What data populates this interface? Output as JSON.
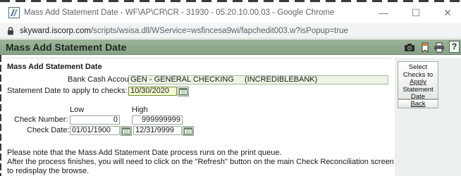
{
  "browser": {
    "window_title": "Mass Add Statement Date - WF\\AP\\CR\\CR - 31930 - 05.20.10.00.03 - Google Chrome",
    "url_host": "skyward.iscorp.com",
    "url_path": "/scripts/wsisa.dll/WService=wsfincesa9wi/fapchedit003.w?isPopup=true",
    "controls": {
      "minimize": "—",
      "maximize": "☐",
      "close": "✕"
    }
  },
  "header": {
    "title": "Mass Add Statement Date",
    "icons": [
      "camera-icon",
      "bookmark-icon",
      "print-icon",
      "help-icon"
    ],
    "help_label": "?"
  },
  "form": {
    "section_title": "Mass Add Statement Date",
    "bank_account": {
      "label": "Bank Cash Account:",
      "value": "GEN - GENERAL CHECKING",
      "bank_name": "(INCREDIBLEBANK)"
    },
    "statement_date": {
      "label": "Statement Date to apply to checks:",
      "value": "10/30/2020"
    },
    "range_headers": {
      "low": "Low",
      "high": "High"
    },
    "check_number": {
      "label": "Check Number:",
      "low": "0",
      "high": "999999999"
    },
    "check_date": {
      "label": "Check Date:",
      "low": "01/01/1900",
      "high": "12/31/9999"
    },
    "notes": [
      "Please note that the Mass Add Statement Date process runs on the print queue.",
      "After the process finishes, you will need to click on the \"Refresh\" button on the main Check Reconciliation screen",
      "to redisplay the browse."
    ]
  },
  "actions": {
    "select_checks_lines": [
      "Select",
      "Checks to",
      "Apply",
      "Statement",
      "Date"
    ],
    "back_label": "Back"
  },
  "colors": {
    "header_bg": "#8fa98f",
    "active_field_bg": "#f6fbd2",
    "readonly_field_bg": "#eef5e6",
    "action_panel_bg": "#edf1ed"
  }
}
